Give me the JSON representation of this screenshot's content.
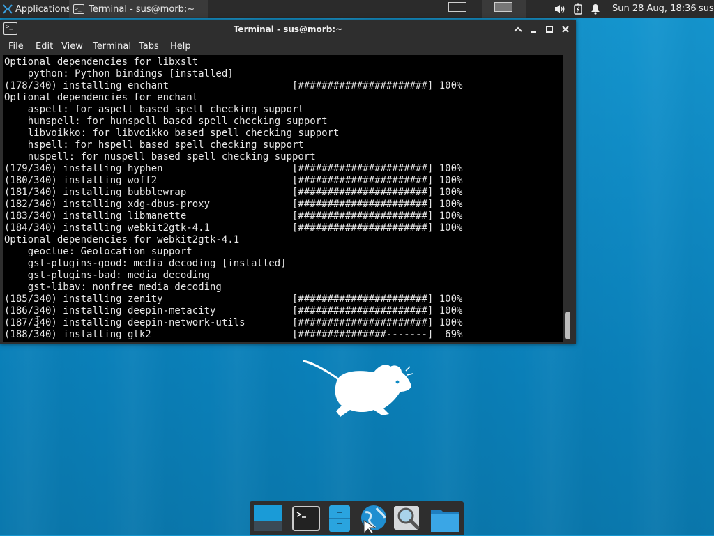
{
  "top_panel": {
    "applications_label": "Applications",
    "task_label": "Terminal - sus@morb:~",
    "separator": "Ξ",
    "clock": "Sun 28 Aug, 18:36",
    "user": "sus",
    "icons": [
      "volume-icon",
      "battery-icon",
      "notification-bell-icon"
    ]
  },
  "window": {
    "title": "Terminal - sus@morb:~",
    "menu": [
      "File",
      "Edit",
      "View",
      "Terminal",
      "Tabs",
      "Help"
    ]
  },
  "terminal": {
    "lines": [
      "Optional dependencies for libxslt",
      "    python: Python bindings [installed]",
      "(178/340) installing enchant                     [######################] 100%",
      "Optional dependencies for enchant",
      "    aspell: for aspell based spell checking support",
      "    hunspell: for hunspell based spell checking support",
      "    libvoikko: for libvoikko based spell checking support",
      "    hspell: for hspell based spell checking support",
      "    nuspell: for nuspell based spell checking support",
      "(179/340) installing hyphen                      [######################] 100%",
      "(180/340) installing woff2                       [######################] 100%",
      "(181/340) installing bubblewrap                  [######################] 100%",
      "(182/340) installing xdg-dbus-proxy              [######################] 100%",
      "(183/340) installing libmanette                  [######################] 100%",
      "(184/340) installing webkit2gtk-4.1              [######################] 100%",
      "Optional dependencies for webkit2gtk-4.1",
      "    geoclue: Geolocation support",
      "    gst-plugins-good: media decoding [installed]",
      "    gst-plugins-bad: media decoding",
      "    gst-libav: nonfree media decoding",
      "(185/340) installing zenity                      [######################] 100%",
      "(186/340) installing deepin-metacity             [######################] 100%",
      "(187/340) installing deepin-network-utils        [######################] 100%",
      "(188/340) installing gtk2                        [###############-------]  69%"
    ],
    "background": "#000000",
    "foreground": "#e6e6e6"
  },
  "dock": {
    "items": [
      "show-desktop-icon",
      "terminal-icon",
      "file-manager-icon",
      "web-browser-icon",
      "app-finder-icon",
      "folder-icon"
    ]
  },
  "colors": {
    "desktop": "#1190cb",
    "panel": "#2b2b2b",
    "window": "#2e2e2e",
    "accent": "#1a9bd7"
  }
}
